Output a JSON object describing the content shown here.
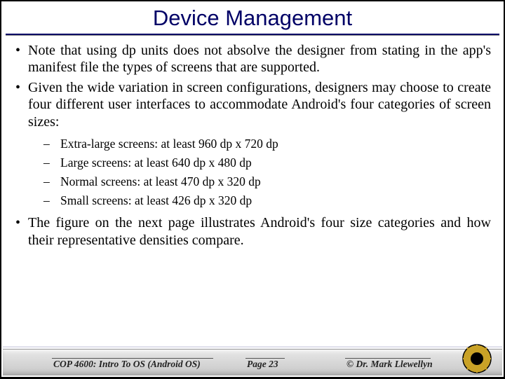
{
  "title": "Device Management",
  "bullets": {
    "b1": "Note that using dp units does not absolve the designer from stating in the app's manifest file the types of screens that are supported.",
    "b2": "Given the wide variation in screen configurations, designers may choose to create four different user interfaces to accommodate Android's four categories of screen sizes:",
    "b3": "The figure on the next page illustrates Android's four size categories and how their representative densities compare."
  },
  "sub": {
    "s1": "Extra-large screens: at least 960 dp x 720 dp",
    "s2": "Large screens: at least 640 dp x 480 dp",
    "s3": "Normal screens: at least 470 dp x 320 dp",
    "s4": "Small screens: at least 426 dp x 320 dp"
  },
  "footer": {
    "course": "COP 4600: Intro To OS  (Android OS)",
    "page": "Page 23",
    "author": "© Dr. Mark Llewellyn"
  },
  "colors": {
    "title": "#000066"
  }
}
